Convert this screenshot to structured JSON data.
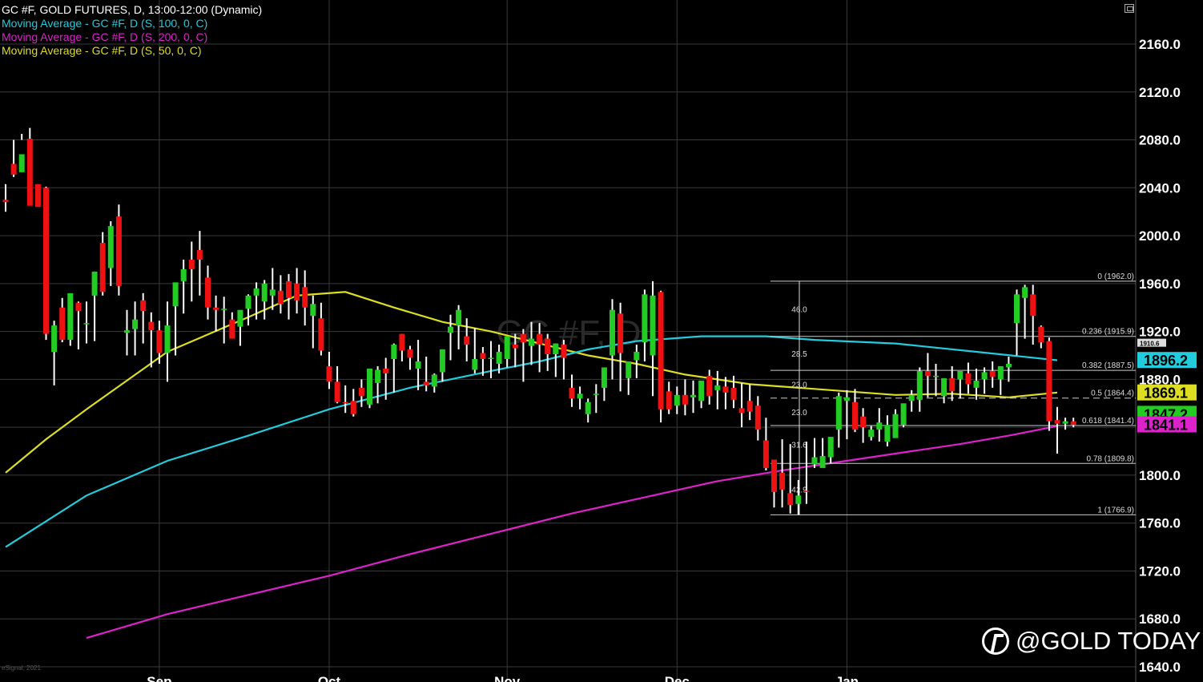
{
  "legend": {
    "title": "GC #F, GOLD FUTURES, D, 13:00-12:00 (Dynamic)",
    "ma100": "Moving Average - GC #F, D (S, 100, 0, C)",
    "ma200": "Moving Average - GC #F, D (S, 200, 0, C)",
    "ma50": "Moving Average - GC #F, D (S, 50, 0, C)"
  },
  "colors": {
    "up": "#22cc22",
    "down": "#ee1111",
    "ma100": "#22ccdd",
    "ma200": "#dd22cc",
    "ma50": "#dddd22",
    "grid": "#3a3a3a",
    "fib": "#cccccc"
  },
  "watermark": "@GOLD TODAY",
  "chart_label": "GC #F, D",
  "copyright": "eSignal, 2021",
  "chart_data": {
    "type": "candlestick",
    "title": "GC #F, GOLD FUTURES, D, 13:00-12:00 (Dynamic)",
    "yaxis": {
      "range": [
        1640,
        2170
      ],
      "ticks": [
        "2160.0",
        "2120.0",
        "2080.0",
        "2040.0",
        "2000.0",
        "1960.0",
        "1920.0",
        "1880.0",
        "1840.0",
        "1800.0",
        "1760.0",
        "1720.0",
        "1680.0",
        "1640.0"
      ],
      "tick_values": [
        2160,
        2120,
        2080,
        2040,
        2000,
        1960,
        1920,
        1880,
        1840,
        1800,
        1760,
        1720,
        1680,
        1640
      ]
    },
    "xaxis": {
      "month_labels": [
        "Sep",
        "Oct",
        "Nov",
        "Dec",
        "Jan"
      ],
      "month_index": [
        19,
        40,
        62,
        83,
        104
      ]
    },
    "candles": [
      [
        2030,
        2043,
        2028,
        2020
      ],
      [
        2060,
        2080,
        2051,
        2049
      ],
      [
        2053,
        2080,
        2068,
        2085
      ],
      [
        2081,
        2090,
        2025,
        2043
      ],
      [
        2043,
        2043,
        2024,
        2027
      ],
      [
        2040,
        2041,
        1918,
        1913
      ],
      [
        1903,
        1929,
        1925,
        1875
      ],
      [
        1940,
        1948,
        1913,
        1911
      ],
      [
        1913,
        1951,
        1952,
        1908
      ],
      [
        1944,
        1945,
        1937,
        1905
      ],
      [
        1927,
        1945,
        1927,
        1910
      ],
      [
        1950,
        1970,
        1970,
        1912
      ],
      [
        1994,
        2003,
        1953,
        1950
      ],
      [
        1973,
        2012,
        2008,
        1958
      ],
      [
        2016,
        2026,
        1958,
        1950
      ],
      [
        1919,
        1938,
        1921,
        1900
      ],
      [
        1922,
        1945,
        1930,
        1900
      ],
      [
        1946,
        1952,
        1937,
        1910
      ],
      [
        1928,
        1936,
        1921,
        1890
      ],
      [
        1921,
        1929,
        1902,
        1893
      ],
      [
        1902,
        1945,
        1925,
        1878
      ],
      [
        1941,
        1951,
        1961,
        1900
      ],
      [
        1962,
        1980,
        1972,
        1935
      ],
      [
        1980,
        1995,
        1972,
        1945
      ],
      [
        1988,
        2004,
        1980,
        1950
      ],
      [
        1965,
        1975,
        1940,
        1930
      ],
      [
        1940,
        1950,
        1938,
        1920
      ],
      [
        1938,
        1949,
        1939,
        1910
      ],
      [
        1930,
        1936,
        1914,
        1915
      ],
      [
        1924,
        1934,
        1938,
        1908
      ],
      [
        1939,
        1951,
        1950,
        1925
      ],
      [
        1950,
        1961,
        1956,
        1930
      ],
      [
        1945,
        1963,
        1960,
        1930
      ],
      [
        1950,
        1973,
        1955,
        1938
      ],
      [
        1954,
        1967,
        1943,
        1935
      ],
      [
        1962,
        1968,
        1948,
        1930
      ],
      [
        1960,
        1973,
        1946,
        1935
      ],
      [
        1957,
        1971,
        1940,
        1925
      ],
      [
        1933,
        1950,
        1943,
        1906
      ],
      [
        1931,
        1944,
        1904,
        1900
      ],
      [
        1891,
        1903,
        1878,
        1872
      ],
      [
        1878,
        1891,
        1861,
        1860
      ],
      [
        1861,
        1875,
        1860,
        1852
      ],
      [
        1862,
        1872,
        1851,
        1849
      ],
      [
        1873,
        1880,
        1866,
        1857
      ],
      [
        1859,
        1874,
        1889,
        1856
      ],
      [
        1877,
        1891,
        1888,
        1860
      ],
      [
        1889,
        1898,
        1885,
        1863
      ],
      [
        1897,
        1910,
        1909,
        1869
      ],
      [
        1918,
        1918,
        1904,
        1895
      ],
      [
        1905,
        1908,
        1898,
        1888
      ],
      [
        1889,
        1913,
        1895,
        1871
      ],
      [
        1878,
        1899,
        1875,
        1870
      ],
      [
        1874,
        1885,
        1884,
        1869
      ],
      [
        1886,
        1893,
        1905,
        1878
      ],
      [
        1919,
        1934,
        1924,
        1896
      ],
      [
        1925,
        1942,
        1938,
        1905
      ],
      [
        1916,
        1931,
        1909,
        1895
      ],
      [
        1888,
        1923,
        1897,
        1885
      ],
      [
        1902,
        1907,
        1897,
        1883
      ],
      [
        1898,
        1912,
        1898,
        1881
      ],
      [
        1893,
        1909,
        1903,
        1885
      ],
      [
        1897,
        1902,
        1916,
        1890
      ],
      [
        1909,
        1918,
        1906,
        1890
      ],
      [
        1918,
        1922,
        1911,
        1878
      ],
      [
        1908,
        1928,
        1914,
        1892
      ],
      [
        1918,
        1927,
        1909,
        1886
      ],
      [
        1914,
        1918,
        1901,
        1887
      ],
      [
        1901,
        1910,
        1910,
        1882
      ],
      [
        1909,
        1913,
        1898,
        1880
      ],
      [
        1873,
        1884,
        1864,
        1857
      ],
      [
        1864,
        1874,
        1868,
        1855
      ],
      [
        1851,
        1864,
        1861,
        1844
      ],
      [
        1867,
        1876,
        1868,
        1852
      ],
      [
        1873,
        1884,
        1890,
        1862
      ],
      [
        1900,
        1947,
        1938,
        1880
      ],
      [
        1935,
        1944,
        1902,
        1870
      ],
      [
        1881,
        1893,
        1895,
        1867
      ],
      [
        1896,
        1909,
        1903,
        1881
      ],
      [
        1911,
        1955,
        1951,
        1895
      ],
      [
        1900,
        1962,
        1950,
        1866
      ],
      [
        1953,
        1954,
        1855,
        1844
      ],
      [
        1870,
        1878,
        1855,
        1851
      ],
      [
        1858,
        1874,
        1867,
        1851
      ],
      [
        1867,
        1880,
        1859,
        1850
      ],
      [
        1865,
        1879,
        1867,
        1852
      ],
      [
        1862,
        1874,
        1879,
        1856
      ],
      [
        1883,
        1888,
        1866,
        1859
      ],
      [
        1871,
        1887,
        1875,
        1855
      ],
      [
        1874,
        1882,
        1869,
        1855
      ],
      [
        1873,
        1883,
        1863,
        1856
      ],
      [
        1856,
        1877,
        1852,
        1840
      ],
      [
        1862,
        1876,
        1853,
        1846
      ],
      [
        1858,
        1866,
        1838,
        1829
      ],
      [
        1829,
        1848,
        1806,
        1804
      ],
      [
        1813,
        1813,
        1786,
        1773
      ],
      [
        1802,
        1830,
        1788,
        1773
      ],
      [
        1785,
        1826,
        1775,
        1768
      ],
      [
        1776,
        1796,
        1783,
        1767
      ],
      [
        1787,
        1828,
        1786,
        1776
      ],
      [
        1809,
        1831,
        1815,
        1806
      ],
      [
        1806,
        1831,
        1816,
        1810
      ],
      [
        1815,
        1831,
        1832,
        1810
      ],
      [
        1838,
        1869,
        1866,
        1823
      ],
      [
        1862,
        1871,
        1865,
        1830
      ],
      [
        1861,
        1872,
        1838,
        1836
      ],
      [
        1849,
        1856,
        1840,
        1827
      ],
      [
        1832,
        1841,
        1838,
        1829
      ],
      [
        1838,
        1856,
        1844,
        1828
      ],
      [
        1828,
        1850,
        1842,
        1824
      ],
      [
        1831,
        1855,
        1851,
        1833
      ],
      [
        1842,
        1854,
        1860,
        1840
      ],
      [
        1862,
        1871,
        1867,
        1853
      ],
      [
        1863,
        1890,
        1887,
        1853
      ],
      [
        1887,
        1902,
        1883,
        1865
      ],
      [
        1883,
        1893,
        1883,
        1866
      ],
      [
        1866,
        1875,
        1881,
        1860
      ],
      [
        1881,
        1891,
        1870,
        1862
      ],
      [
        1880,
        1886,
        1887,
        1864
      ],
      [
        1885,
        1894,
        1876,
        1868
      ],
      [
        1873,
        1889,
        1879,
        1863
      ],
      [
        1880,
        1890,
        1886,
        1868
      ],
      [
        1887,
        1895,
        1882,
        1873
      ],
      [
        1880,
        1888,
        1891,
        1867
      ],
      [
        1890,
        1899,
        1893,
        1878
      ],
      [
        1927,
        1955,
        1951,
        1900
      ],
      [
        1948,
        1959,
        1957,
        1914
      ],
      [
        1951,
        1959,
        1933,
        1909
      ],
      [
        1924,
        1925,
        1911,
        1906
      ],
      [
        1912,
        1915,
        1845,
        1837
      ],
      [
        1846,
        1857,
        1843,
        1818
      ],
      [
        1843,
        1848,
        1845,
        1838
      ],
      [
        1845,
        1848,
        1842,
        1840
      ]
    ],
    "fibonacci": {
      "levels": [
        {
          "ratio": "0",
          "value": 1962.0,
          "label": "0 (1962.0)"
        },
        {
          "ratio": "0.236",
          "value": 1915.9,
          "label": "0.236 (1915.9)"
        },
        {
          "ratio": "0.382",
          "value": 1887.5,
          "label": "0.382 (1887.5)"
        },
        {
          "ratio": "0.5",
          "value": 1864.4,
          "label": "0.5 (1864.4)"
        },
        {
          "ratio": "0.618",
          "value": 1841.4,
          "label": "0.618 (1841.4)"
        },
        {
          "ratio": "0.78",
          "value": 1809.8,
          "label": "0.78 (1809.8)"
        },
        {
          "ratio": "1",
          "value": 1766.9,
          "label": "1 (1766.9)"
        }
      ],
      "spans": [
        {
          "label": "46.0",
          "from": 1962.0,
          "to": 1915.9
        },
        {
          "label": "28.5",
          "from": 1915.9,
          "to": 1887.5
        },
        {
          "label": "23.0",
          "from": 1887.5,
          "to": 1864.4
        },
        {
          "label": "23.0",
          "from": 1864.4,
          "to": 1841.4
        },
        {
          "label": "31.6",
          "from": 1841.4,
          "to": 1809.8
        },
        {
          "label": "42.9",
          "from": 1809.8,
          "to": 1766.9
        }
      ]
    },
    "price_tags": [
      {
        "label": "1896.2",
        "value": 1896.2,
        "series": "ma100"
      },
      {
        "label": "1869.1",
        "value": 1869.1,
        "series": "ma50"
      },
      {
        "label": "1847.2",
        "value": 1847.2,
        "series": "price"
      },
      {
        "label": "1841.1",
        "value": 1841.1,
        "series": "ma200"
      },
      {
        "label": "1910.6",
        "value": 1910.6,
        "series": "level"
      }
    ],
    "moving_averages": [
      {
        "name": "ma50",
        "points": [
          [
            0,
            1802
          ],
          [
            5,
            1830
          ],
          [
            10,
            1855
          ],
          [
            20,
            1903
          ],
          [
            30,
            1932
          ],
          [
            36,
            1950
          ],
          [
            42,
            1953
          ],
          [
            48,
            1940
          ],
          [
            54,
            1928
          ],
          [
            60,
            1920
          ],
          [
            66,
            1910
          ],
          [
            72,
            1900
          ],
          [
            78,
            1893
          ],
          [
            84,
            1884
          ],
          [
            88,
            1880
          ],
          [
            92,
            1876
          ],
          [
            96,
            1874
          ],
          [
            100,
            1872
          ],
          [
            104,
            1870
          ],
          [
            110,
            1867
          ],
          [
            117,
            1868
          ],
          [
            124,
            1865
          ],
          [
            130,
            1869
          ]
        ]
      },
      {
        "name": "ma100",
        "points": [
          [
            0,
            1740
          ],
          [
            10,
            1783
          ],
          [
            20,
            1812
          ],
          [
            30,
            1833
          ],
          [
            40,
            1855
          ],
          [
            50,
            1873
          ],
          [
            60,
            1887
          ],
          [
            66,
            1895
          ],
          [
            72,
            1905
          ],
          [
            78,
            1912
          ],
          [
            86,
            1916
          ],
          [
            94,
            1916
          ],
          [
            100,
            1913
          ],
          [
            110,
            1910
          ],
          [
            120,
            1903
          ],
          [
            130,
            1896
          ]
        ]
      },
      {
        "name": "ma200",
        "points": [
          [
            10,
            1664
          ],
          [
            20,
            1684
          ],
          [
            30,
            1700
          ],
          [
            40,
            1716
          ],
          [
            50,
            1734
          ],
          [
            60,
            1751
          ],
          [
            70,
            1768
          ],
          [
            80,
            1783
          ],
          [
            88,
            1795
          ],
          [
            96,
            1804
          ],
          [
            104,
            1812
          ],
          [
            110,
            1818
          ],
          [
            118,
            1826
          ],
          [
            124,
            1833
          ],
          [
            130,
            1841
          ]
        ]
      }
    ]
  }
}
